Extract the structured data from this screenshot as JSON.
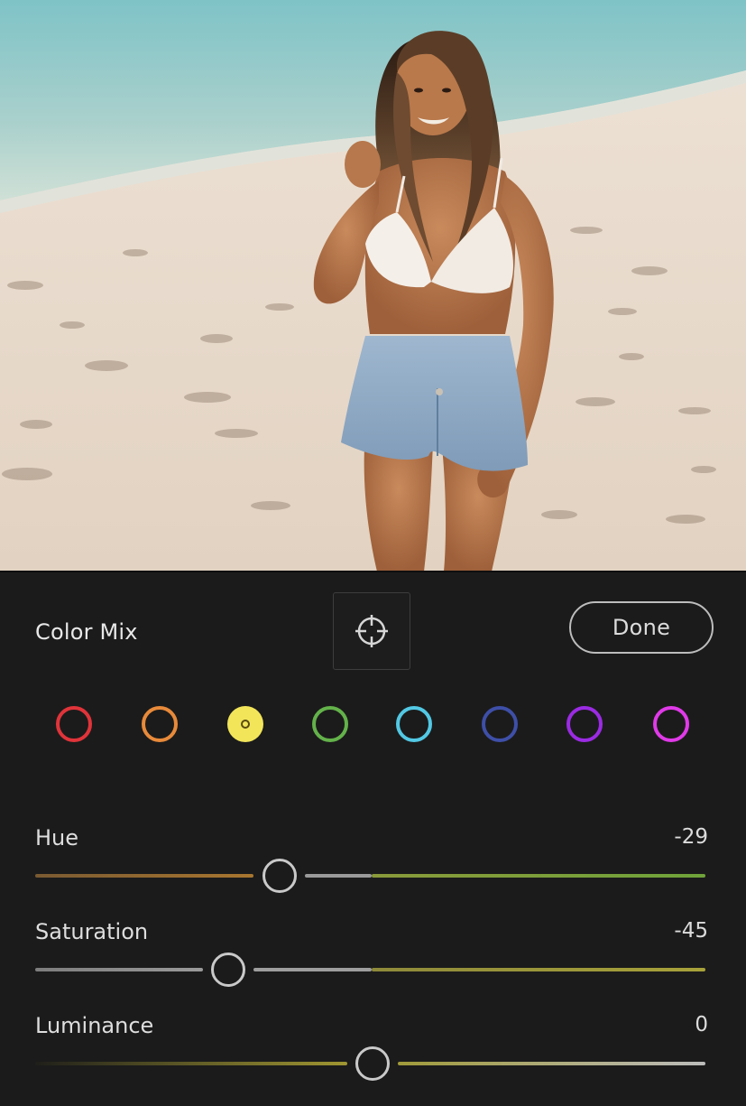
{
  "photo": {
    "icon": "beach-portrait-photo"
  },
  "panel": {
    "title": "Color Mix",
    "targeted_adjustment_icon": "crosshair-icon",
    "done_label": "Done"
  },
  "color_swatches": [
    {
      "name": "red",
      "color": "#e0343a",
      "selected": false
    },
    {
      "name": "orange",
      "color": "#e88a3a",
      "selected": false
    },
    {
      "name": "yellow",
      "color": "#f2e55a",
      "selected": true
    },
    {
      "name": "green",
      "color": "#63b24a",
      "selected": false
    },
    {
      "name": "aqua",
      "color": "#52c8e4",
      "selected": false
    },
    {
      "name": "blue",
      "color": "#3e4fa8",
      "selected": false
    },
    {
      "name": "purple",
      "color": "#9b2be3",
      "selected": false
    },
    {
      "name": "magenta",
      "color": "#e03ae8",
      "selected": false
    }
  ],
  "sliders": {
    "hue": {
      "label": "Hue",
      "value": "-29",
      "numeric": -29
    },
    "saturation": {
      "label": "Saturation",
      "value": "-45",
      "numeric": -45
    },
    "luminance": {
      "label": "Luminance",
      "value": "0",
      "numeric": 0
    }
  },
  "accent_colors": {
    "hue_left": "#9a6a36",
    "hue_right": "#7aa03a",
    "sat_left": "#8a8a8a",
    "sat_right": "#a39a3a",
    "lum_left": "#9a9030",
    "lum_right": "#b8b8b8"
  }
}
